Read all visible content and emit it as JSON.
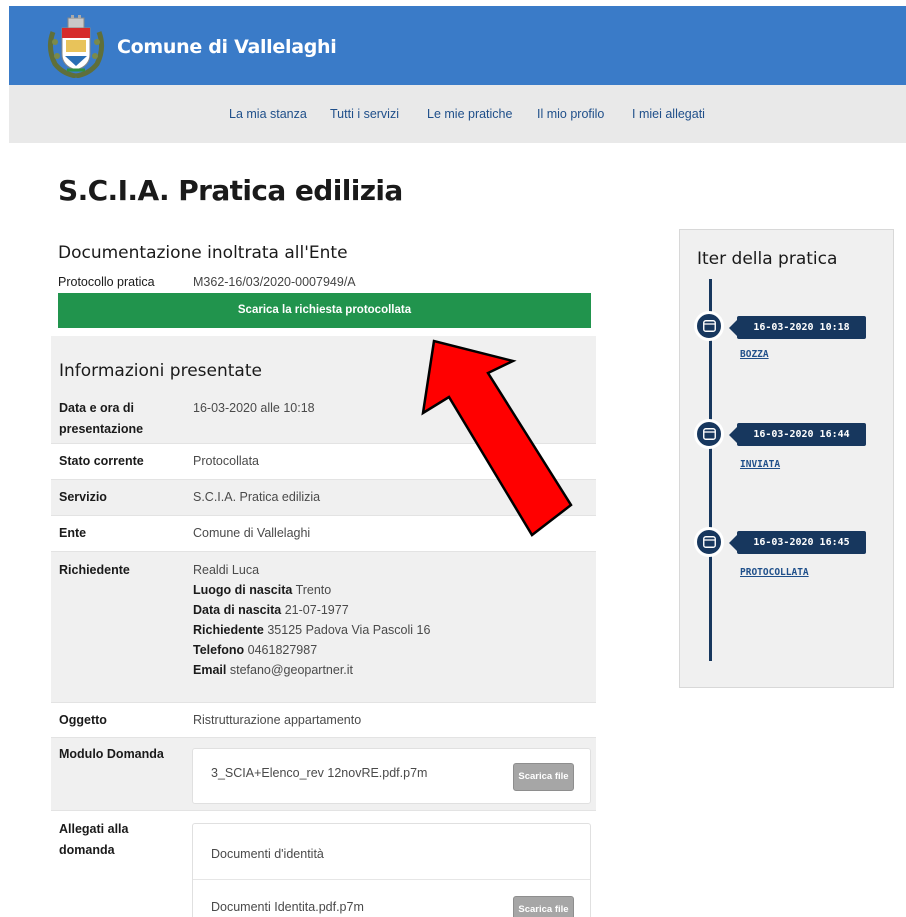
{
  "header": {
    "site_title": "Comune di Vallelaghi",
    "color": "#3a7bc8"
  },
  "nav": {
    "items": [
      {
        "label": "La mia stanza"
      },
      {
        "label": "Tutti i servizi"
      },
      {
        "label": "Le mie pratiche"
      },
      {
        "label": "Il mio profilo"
      },
      {
        "label": "I miei allegati"
      }
    ]
  },
  "page": {
    "title": "S.C.I.A. Pratica edilizia",
    "section_title": "Documentazione inoltrata all'Ente",
    "protocol_label": "Protocollo pratica",
    "protocol_value": "M362-16/03/2020-0007949/A",
    "download_label": "Scarica la richiesta protocollata"
  },
  "info": {
    "title": "Informazioni presentate",
    "rows": [
      {
        "label": "Data e ora di presentazione",
        "value": "16-03-2020 alle 10:18"
      },
      {
        "label": "Stato corrente",
        "value": "Protocollata"
      },
      {
        "label": "Servizio",
        "value": "S.C.I.A. Pratica edilizia"
      },
      {
        "label": "Ente",
        "value": "Comune di Vallelaghi"
      },
      {
        "label": "Richiedente",
        "value": "Realdi Luca"
      },
      {
        "label": "Oggetto",
        "value": "Ristrutturazione appartamento"
      },
      {
        "label": "Modulo Domanda"
      },
      {
        "label": "Allegati alla domanda"
      }
    ],
    "applicant": {
      "birthplace_label": "Luogo di nascita",
      "birthplace": "Trento",
      "birthdate_label": "Data di nascita",
      "birthdate": "21-07-1977",
      "address_label": "Richiedente",
      "address": "35125 Padova Via Pascoli 16",
      "phone_label": "Telefono",
      "phone": "0461827987",
      "email_label": "Email",
      "email": "stefano@geopartner.it"
    },
    "modulo_file": "3_SCIA+Elenco_rev 12novRE.pdf.p7m",
    "attachments_group": "Documenti d'identità",
    "attachment_file": "Documenti Identita.pdf.p7m",
    "file_button": "Scarica file"
  },
  "sidebar": {
    "title": "Iter della pratica",
    "events": [
      {
        "datetime": "16-03-2020 10:18",
        "status": "BOZZA"
      },
      {
        "datetime": "16-03-2020 16:44",
        "status": "INVIATA"
      },
      {
        "datetime": "16-03-2020 16:45",
        "status": "PROTOCOLLATA"
      }
    ]
  },
  "colors": {
    "accent_green": "#21944d",
    "timeline_navy": "#17375e",
    "annotation_arrow": "#ff0000"
  }
}
